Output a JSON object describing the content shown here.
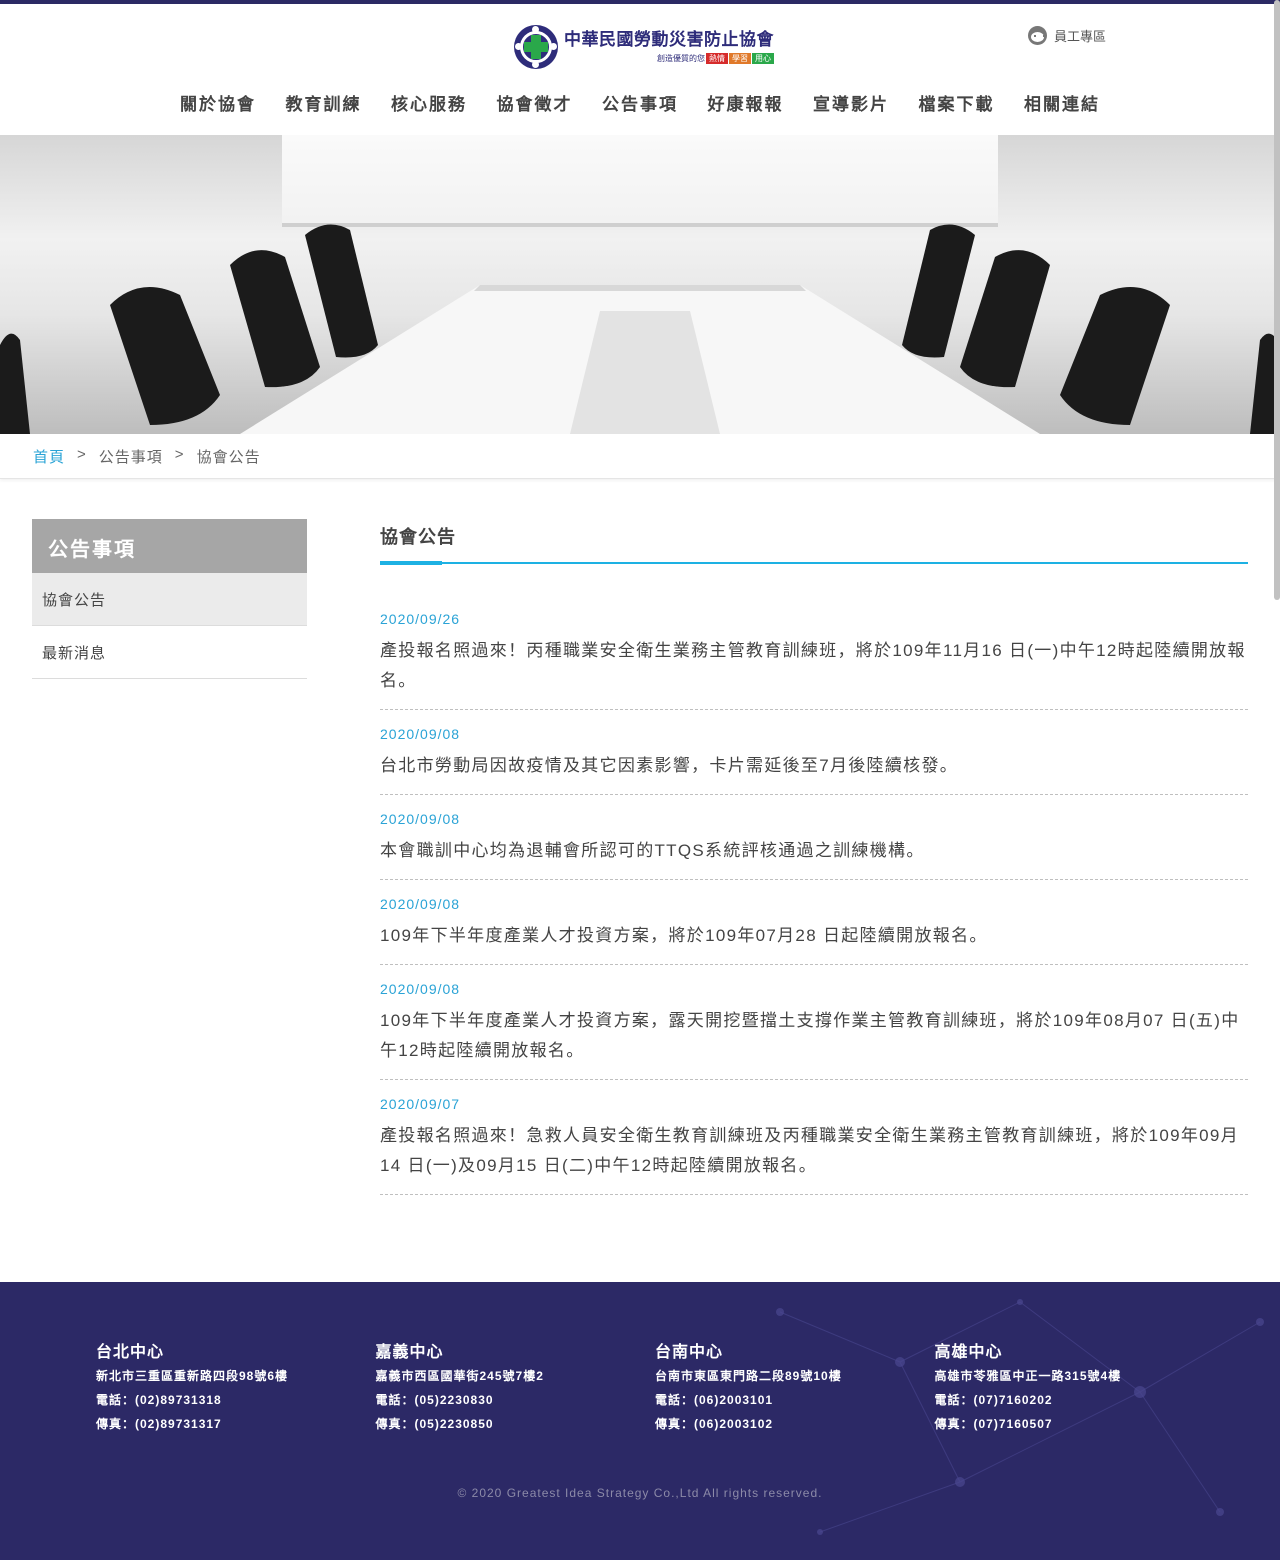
{
  "header": {
    "logo_title": "中華民國勞動災害防止協會",
    "logo_sub_prefix": "創造優質的您",
    "logo_tags": [
      {
        "label": "熱情",
        "color": "#d62b2b"
      },
      {
        "label": "學習",
        "color": "#e0792a"
      },
      {
        "label": "用心",
        "color": "#2aa84a"
      }
    ],
    "staff_label": "員工專區"
  },
  "nav": {
    "items": [
      "關於協會",
      "教育訓練",
      "核心服務",
      "協會徵才",
      "公告事項",
      "好康報報",
      "宣導影片",
      "檔案下載",
      "相關連結"
    ]
  },
  "breadcrumb": {
    "home": "首頁",
    "sep": ">",
    "level1": "公告事項",
    "level2": "協會公告"
  },
  "sidebar": {
    "title": "公告事項",
    "items": [
      "協會公告",
      "最新消息"
    ]
  },
  "main": {
    "title": "協會公告",
    "news": [
      {
        "date": "2020/09/26",
        "text": "產投報名照過來！丙種職業安全衛生業務主管教育訓練班，將於109年11月16 日(一)中午12時起陸續開放報名。"
      },
      {
        "date": "2020/09/08",
        "text": "台北市勞動局因故疫情及其它因素影響，卡片需延後至7月後陸續核發。"
      },
      {
        "date": "2020/09/08",
        "text": "本會職訓中心均為退輔會所認可的TTQS系統評核通過之訓練機構。"
      },
      {
        "date": "2020/09/08",
        "text": "109年下半年度產業人才投資方案，將於109年07月28 日起陸續開放報名。"
      },
      {
        "date": "2020/09/08",
        "text": "109年下半年度產業人才投資方案，露天開挖暨擋土支撐作業主管教育訓練班，將於109年08月07 日(五)中午12時起陸續開放報名。"
      },
      {
        "date": "2020/09/07",
        "text": "產投報名照過來！急救人員安全衛生教育訓練班及丙種職業安全衛生業務主管教育訓練班，將於109年09月14 日(一)及09月15 日(二)中午12時起陸續開放報名。"
      }
    ]
  },
  "footer": {
    "centers": [
      {
        "name": "台北中心",
        "address": "新北市三重區重新路四段98號6樓",
        "phone": "電話：(02)89731318",
        "fax": "傳真：(02)89731317"
      },
      {
        "name": "嘉義中心",
        "address": "嘉義市西區國華街245號7樓2",
        "phone": "電話：(05)2230830",
        "fax": "傳真：(05)2230850"
      },
      {
        "name": "台南中心",
        "address": "台南市東區東門路二段89號10樓",
        "phone": "電話：(06)2003101",
        "fax": "傳真：(06)2003102"
      },
      {
        "name": "高雄中心",
        "address": "高雄市苓雅區中正一路315號4樓",
        "phone": "電話：(07)7160202",
        "fax": "傳真：(07)7160507"
      }
    ],
    "copyright": "© 2020 Greatest Idea Strategy Co.,Ltd All rights reserved."
  },
  "colors": {
    "brand_navy": "#2c2966",
    "accent_blue": "#1db1e3",
    "link_blue": "#2aa3d6",
    "sidebar_head": "#a6a6a6"
  }
}
